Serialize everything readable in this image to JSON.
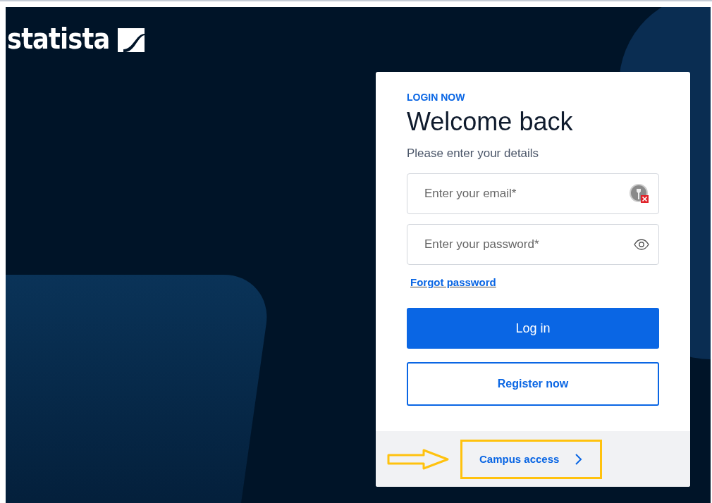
{
  "logo": {
    "text": "statista"
  },
  "login": {
    "eyebrow": "LOGIN NOW",
    "title": "Welcome back",
    "subtitle": "Please enter your details",
    "fields": [
      {
        "kind": "email",
        "placeholder": "Enter your email*"
      },
      {
        "kind": "password",
        "placeholder": "Enter your password*"
      }
    ],
    "forgot_link": "Forgot password",
    "primary_button": "Log in",
    "secondary_button": "Register now",
    "campus_link": {
      "label": "Campus access",
      "highlighted": true
    }
  }
}
